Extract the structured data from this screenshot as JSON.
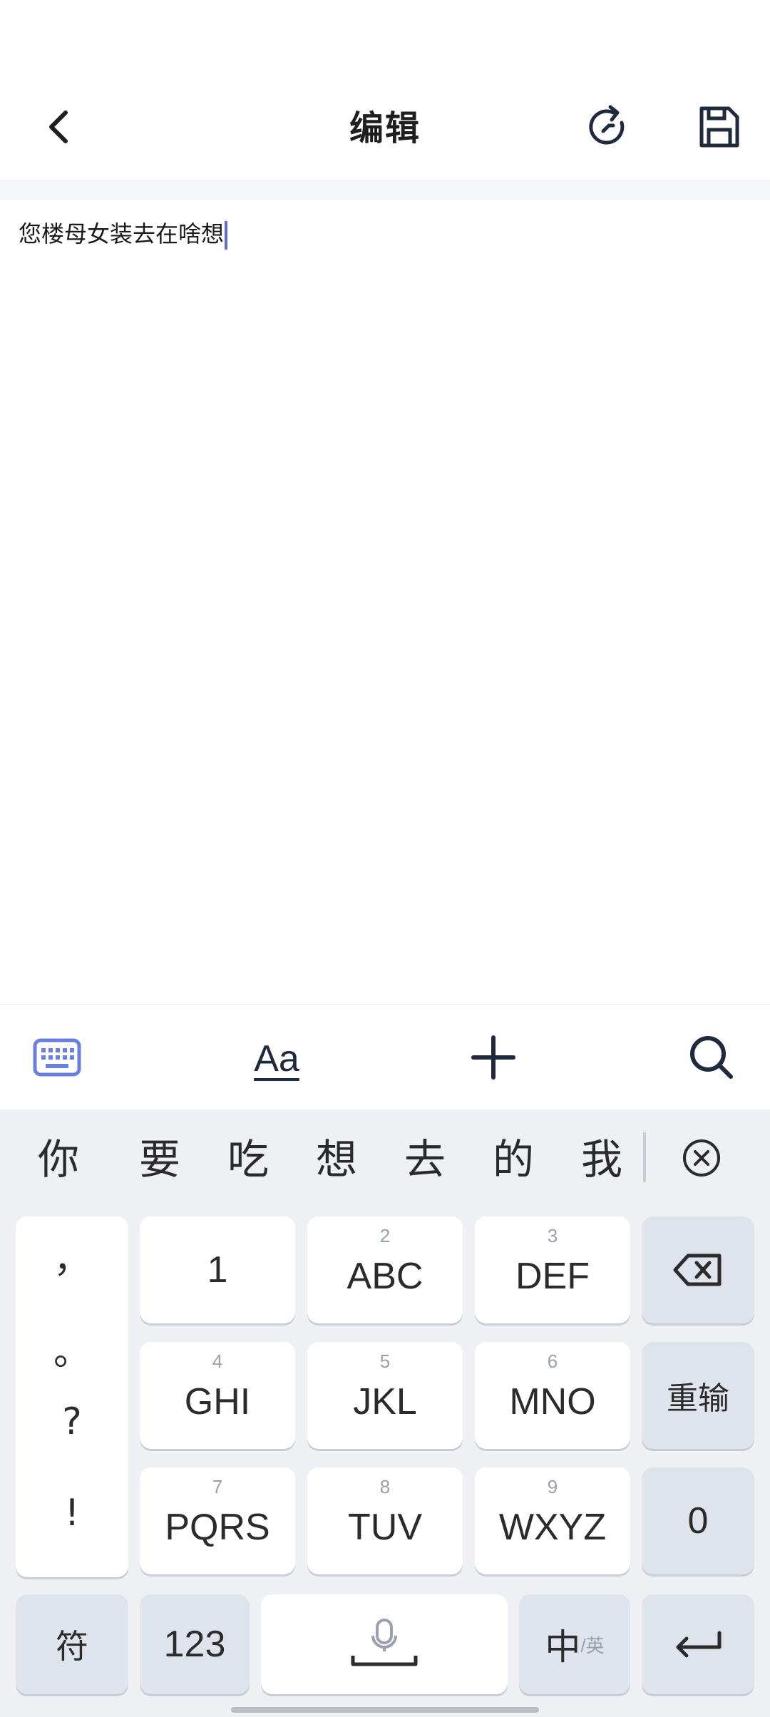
{
  "header": {
    "title": "编辑"
  },
  "editor": {
    "content": "您楼母女装去在啥想"
  },
  "toolbar": {
    "format_label": "Aa"
  },
  "candidates": [
    "你",
    "要",
    "吃",
    "想",
    "去",
    "的",
    "我"
  ],
  "keyboard": {
    "punctuation": [
      "，",
      "。",
      "?",
      "!"
    ],
    "row1": [
      {
        "main": "1",
        "sub": ""
      },
      {
        "main": "ABC",
        "sub": "2"
      },
      {
        "main": "DEF",
        "sub": "3"
      }
    ],
    "row2": [
      {
        "main": "GHI",
        "sub": "4"
      },
      {
        "main": "JKL",
        "sub": "5"
      },
      {
        "main": "MNO",
        "sub": "6"
      }
    ],
    "row3": [
      {
        "main": "PQRS",
        "sub": "7"
      },
      {
        "main": "TUV",
        "sub": "8"
      },
      {
        "main": "WXYZ",
        "sub": "9"
      }
    ],
    "reinput_label": "重输",
    "zero_label": "0",
    "symbol_label": "符",
    "num_label": "123",
    "lang_main": "中",
    "lang_sub": "/英"
  },
  "colors": {
    "accent": "#5b6fd6",
    "keyboard_bg": "#eff0f4",
    "func_key_bg": "#dfe3ec"
  }
}
